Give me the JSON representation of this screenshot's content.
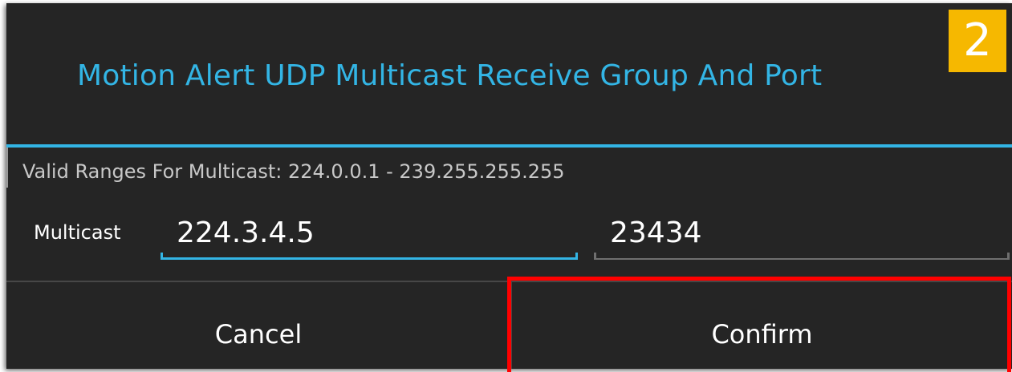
{
  "dialog": {
    "title": "Motion Alert UDP Multicast Receive Group And Port",
    "step_badge": "2",
    "valid_ranges_text": "Valid Ranges For Multicast: 224.0.0.1 - 239.255.255.255",
    "multicast_label": "Multicast",
    "group_address_value": "224.3.4.5",
    "port_value": "23434",
    "cancel_label": "Cancel",
    "confirm_label": "Confirm"
  },
  "colors": {
    "accent": "#33b5e5",
    "dialog_background": "#252525",
    "badge_background": "#f6b800",
    "highlight_outline": "#ff0000"
  }
}
